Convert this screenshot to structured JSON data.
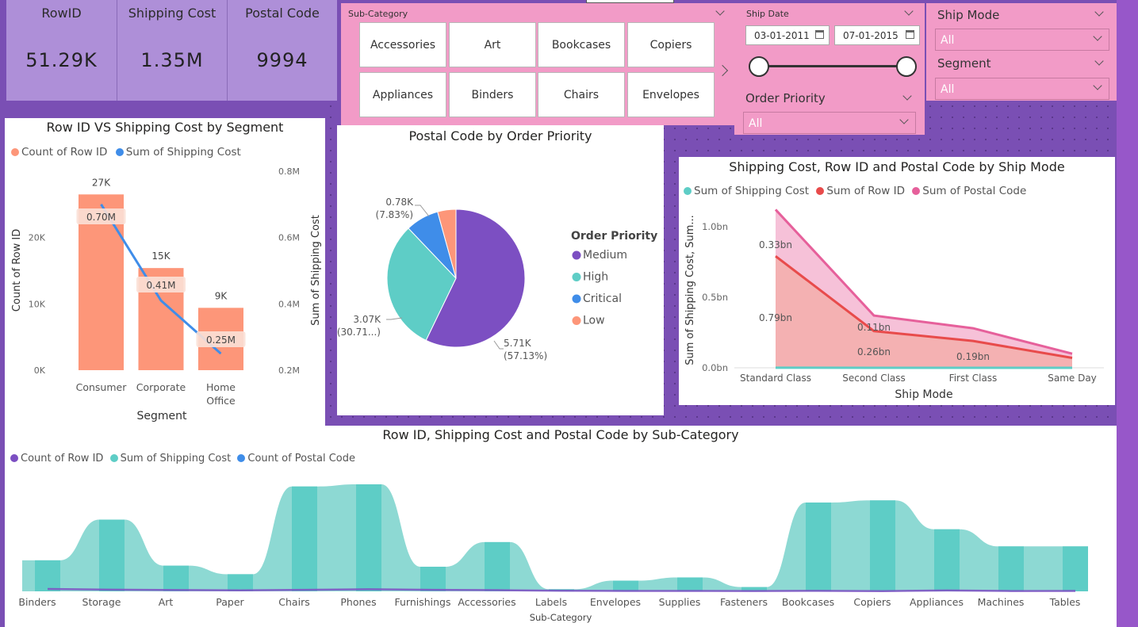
{
  "kpis": [
    {
      "label": "RowID",
      "value": "51.29K"
    },
    {
      "label": "Shipping Cost",
      "value": "1.35M"
    },
    {
      "label": "Postal Code",
      "value": "9994"
    }
  ],
  "subcategory_slicer": {
    "title": "Sub-Category",
    "tiles": [
      "Accessories",
      "Art",
      "Bookcases",
      "Copiers",
      "Appliances",
      "Binders",
      "Chairs",
      "Envelopes"
    ]
  },
  "ship_date_slicer": {
    "title": "Ship Date",
    "start": "03-01-2011",
    "end": "07-01-2015"
  },
  "order_priority_slicer": {
    "title": "Order Priority",
    "value": "All"
  },
  "ship_mode_slicer": {
    "title": "Ship Mode",
    "value": "All"
  },
  "segment_slicer": {
    "title": "Segment",
    "value": "All"
  },
  "colors": {
    "salmon": "#fd9679",
    "blue": "#3f8de9",
    "purple": "#7c4fc2",
    "teal": "#5ecdc6",
    "red": "#e84b4b",
    "pink": "#e6609b",
    "pinkpanel": "#f29bc7",
    "kpi": "#ae8fd8"
  },
  "chart_data": [
    {
      "type": "bar",
      "title": "Row ID VS Shipping Cost by Segment",
      "legend": [
        "Count of Row ID",
        "Sum of Shipping Cost"
      ],
      "xlabel": "Segment",
      "ylabel": "Count of Row ID",
      "y2label": "Sum of Shipping Cost",
      "categories": [
        "Consumer",
        "Corporate",
        "Home Office"
      ],
      "category_lines": [
        [
          "Consumer"
        ],
        [
          "Corporate"
        ],
        [
          "Home",
          "Office"
        ]
      ],
      "bar_values": [
        26500,
        15400,
        9400
      ],
      "bar_labels": [
        "27K",
        "15K",
        "9K"
      ],
      "line_values": [
        0.7,
        0.41,
        0.25
      ],
      "line_labels": [
        "0.70M",
        "0.41M",
        "0.25M"
      ],
      "yticks": [
        "0K",
        "10K",
        "20K"
      ],
      "y2ticks": [
        "0.2M",
        "0.4M",
        "0.6M",
        "0.8M"
      ],
      "ylim": [
        0,
        30000
      ],
      "y2lim": [
        0.2,
        0.8
      ]
    },
    {
      "type": "pie",
      "title": "Postal Code by Order Priority",
      "legend_title": "Order Priority",
      "slices": [
        {
          "name": "Medium",
          "value": 5.71,
          "label": "5.71K",
          "pct": "(57.13%)",
          "color": "#7c4fc2"
        },
        {
          "name": "High",
          "value": 3.07,
          "label": "3.07K",
          "pct": "(30.71...)",
          "color": "#5ecdc6"
        },
        {
          "name": "Critical",
          "value": 0.78,
          "label": "",
          "pct": "",
          "color": "#3f8de9"
        },
        {
          "name": "Low",
          "value": 0.43,
          "label": "0.78K",
          "pct": "(7.83%)",
          "color": "#fd9679"
        }
      ]
    },
    {
      "type": "area",
      "title": "Shipping Cost, Row ID and Postal Code by Ship Mode",
      "legend": [
        "Sum of Shipping Cost",
        "Sum of Row ID",
        "Sum of Postal Code"
      ],
      "xlabel": "Ship Mode",
      "ylabel": "Sum of Shipping Cost, Sum...",
      "categories": [
        "Standard Class",
        "Second Class",
        "First Class",
        "Same Day"
      ],
      "yticks": [
        "0.0bn",
        "0.5bn",
        "1.0bn"
      ],
      "ylim": [
        0,
        1.1
      ],
      "series": [
        {
          "name": "Sum of Shipping Cost",
          "values": [
            0.0007,
            0.0003,
            0.0003,
            0.0001
          ]
        },
        {
          "name": "Sum of Row ID",
          "values": [
            0.79,
            0.26,
            0.19,
            0.07
          ]
        },
        {
          "name": "Sum of Postal Code",
          "values": [
            1.12,
            0.37,
            0.28,
            0.1
          ]
        }
      ],
      "data_labels": [
        {
          "text": "0.33bn"
        },
        {
          "text": "0.79bn"
        },
        {
          "text": "0.11bn"
        },
        {
          "text": "0.26bn"
        },
        {
          "text": "0.19bn"
        }
      ]
    },
    {
      "type": "area",
      "title": "Row ID, Shipping Cost and Postal Code by Sub-Category",
      "legend": [
        "Count of Row ID",
        "Sum of Shipping Cost",
        "Count of Postal Code"
      ],
      "xlabel": "Sub-Category",
      "categories": [
        "Binders",
        "Storage",
        "Art",
        "Paper",
        "Chairs",
        "Phones",
        "Furnishings",
        "Accessories",
        "Labels",
        "Envelopes",
        "Supplies",
        "Fasteners",
        "Bookcases",
        "Copiers",
        "Appliances",
        "Machines",
        "Tables"
      ],
      "shipping_cost": [
        0.29,
        0.67,
        0.24,
        0.16,
        0.98,
        1.0,
        0.23,
        0.46,
        0.02,
        0.1,
        0.13,
        0.04,
        0.83,
        0.85,
        0.58,
        0.42,
        0.42
      ],
      "row_id_count": [
        0.022,
        0.016,
        0.012,
        0.009,
        0.014,
        0.019,
        0.014,
        0.011,
        0.006,
        0.004,
        0.004,
        0.003,
        0.005,
        0.002,
        0.008,
        0.003,
        0.004
      ]
    }
  ]
}
